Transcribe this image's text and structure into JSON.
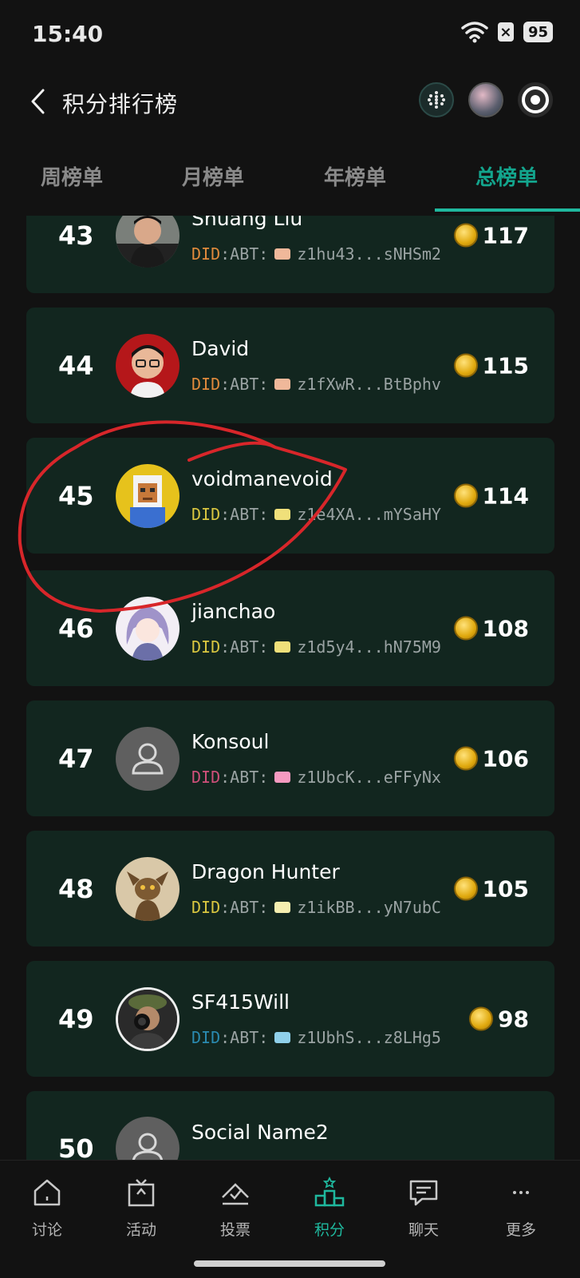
{
  "status_bar": {
    "time": "15:40",
    "battery": "95"
  },
  "header": {
    "title": "积分排行榜"
  },
  "tabs": [
    {
      "label": "周榜单",
      "active": false
    },
    {
      "label": "月榜单",
      "active": false
    },
    {
      "label": "年榜单",
      "active": false
    },
    {
      "label": "总榜单",
      "active": true
    }
  ],
  "leaderboard": [
    {
      "rank": "43",
      "name": "Shuang Liu",
      "did_prefix": "DID",
      "did_mid": ":ABT:",
      "did_address": "z1hu43...sNHSm2",
      "prefix_color": "#e08a3c",
      "chip_color": "#f0b89a",
      "points": "117"
    },
    {
      "rank": "44",
      "name": "David",
      "did_prefix": "DID",
      "did_mid": ":ABT:",
      "did_address": "z1fXwR...BtBphv",
      "prefix_color": "#e08a3c",
      "chip_color": "#f0b89a",
      "points": "115"
    },
    {
      "rank": "45",
      "name": "voidmanevoid",
      "did_prefix": "DID",
      "did_mid": ":ABT:",
      "did_address": "z1e4XA...mYSaHY",
      "prefix_color": "#d9c640",
      "chip_color": "#f0e07a",
      "points": "114"
    },
    {
      "rank": "46",
      "name": "jianchao",
      "did_prefix": "DID",
      "did_mid": ":ABT:",
      "did_address": "z1d5y4...hN75M9",
      "prefix_color": "#d9c640",
      "chip_color": "#f0e07a",
      "points": "108"
    },
    {
      "rank": "47",
      "name": "Konsoul",
      "did_prefix": "DID",
      "did_mid": ":ABT:",
      "did_address": "z1UbcK...eFFyNx",
      "prefix_color": "#d0507a",
      "chip_color": "#f59ac0",
      "points": "106"
    },
    {
      "rank": "48",
      "name": "Dragon Hunter",
      "did_prefix": "DID",
      "did_mid": ":ABT:",
      "did_address": "z1ikBB...yN7ubC",
      "prefix_color": "#d9c640",
      "chip_color": "#f5eeb0",
      "points": "105"
    },
    {
      "rank": "49",
      "name": "SF415Will",
      "did_prefix": "DID",
      "did_mid": ":ABT:",
      "did_address": "z1UbhS...z8LHg5",
      "prefix_color": "#2a8ab0",
      "chip_color": "#8fd0ea",
      "points": "98"
    },
    {
      "rank": "50",
      "name": "Social Name2",
      "did_prefix": "",
      "did_mid": "",
      "did_address": "",
      "prefix_color": "#9aa3a3",
      "chip_color": "#9aa3a3",
      "points": ""
    }
  ],
  "bottom_nav": [
    {
      "label": "讨论",
      "icon": "home-icon"
    },
    {
      "label": "活动",
      "icon": "gift-icon"
    },
    {
      "label": "投票",
      "icon": "vote-icon"
    },
    {
      "label": "积分",
      "icon": "podium-icon",
      "active": true
    },
    {
      "label": "聊天",
      "icon": "chat-icon"
    },
    {
      "label": "更多",
      "icon": "more-icon"
    }
  ]
}
